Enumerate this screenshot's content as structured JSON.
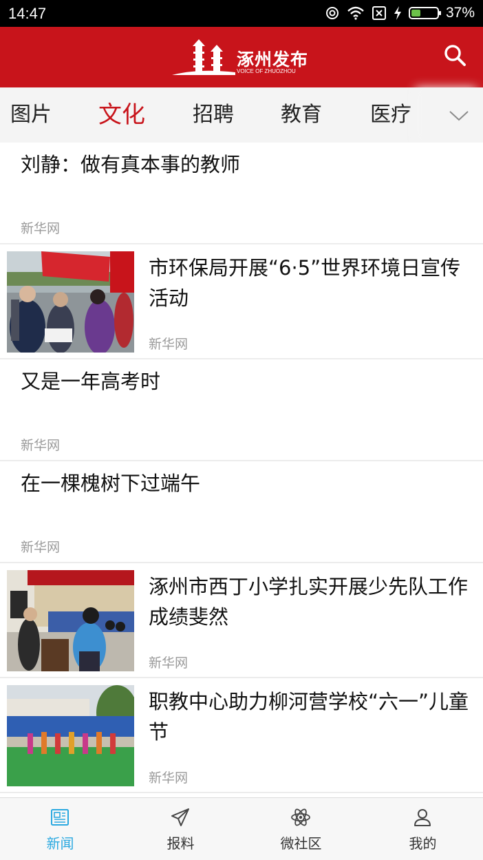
{
  "status": {
    "time": "14:47",
    "battery": "37%",
    "battery_level": 0.37
  },
  "header": {
    "logo_title": "涿州发布",
    "logo_subtitle": "VOICE OF ZHUOZHOU",
    "search_icon": "search-icon",
    "color": "#c8141b"
  },
  "tabs": {
    "items": [
      "图片",
      "文化",
      "招聘",
      "教育",
      "医疗"
    ],
    "active": "文化",
    "more_icon": "chevron-down-icon"
  },
  "feed": [
    {
      "title": "刘静：做有真本事的教师",
      "source": "新华网",
      "has_image": false
    },
    {
      "title": "市环保局开展“6·5”世界环境日宣传活动",
      "source": "新华网",
      "has_image": true
    },
    {
      "title": "又是一年高考时",
      "source": "新华网",
      "has_image": false
    },
    {
      "title": "在一棵槐树下过端午",
      "source": "新华网",
      "has_image": false
    },
    {
      "title": "涿州市西丁小学扎实开展少先队工作成绩斐然",
      "source": "新华网",
      "has_image": true
    },
    {
      "title": "职教中心助力柳河营学校“六一”儿童节",
      "source": "新华网",
      "has_image": true
    }
  ],
  "bottom_nav": {
    "items": [
      {
        "label": "新闻",
        "icon": "newspaper-icon"
      },
      {
        "label": "报料",
        "icon": "paper-plane-icon"
      },
      {
        "label": "微社区",
        "icon": "atom-icon"
      },
      {
        "label": "我的",
        "icon": "user-icon"
      }
    ],
    "active": "新闻",
    "active_color": "#29a8e0"
  }
}
